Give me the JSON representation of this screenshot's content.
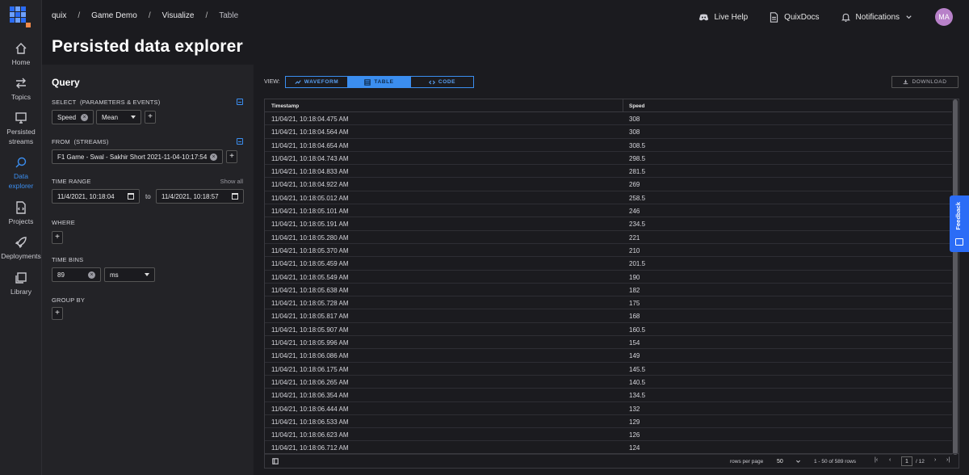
{
  "nav": {
    "items": [
      {
        "label": "Home",
        "icon": "home-icon"
      },
      {
        "label": "Topics",
        "icon": "arrows-icon"
      },
      {
        "label": "Persisted streams",
        "icon": "monitor-icon"
      },
      {
        "label": "Data explorer",
        "icon": "explore-icon"
      },
      {
        "label": "Projects",
        "icon": "code-file-icon"
      },
      {
        "label": "Deployments",
        "icon": "rocket-icon"
      },
      {
        "label": "Library",
        "icon": "library-icon"
      }
    ]
  },
  "header": {
    "breadcrumbs": [
      "quix",
      "Game Demo",
      "Visualize",
      "Table"
    ],
    "separator": "/",
    "title": "Persisted data explorer",
    "live_help": "Live Help",
    "docs": "QuixDocs",
    "notifications": "Notifications",
    "avatar": "MA"
  },
  "query": {
    "title": "Query",
    "select_label": "SELECT",
    "select_sub": "(PARAMETERS & EVENTS)",
    "select_param": "Speed",
    "select_agg": "Mean",
    "from_label": "FROM",
    "from_sub": "(STREAMS)",
    "from_stream": "F1 Game - Swal - Sakhir Short 2021-11-04-10:17:54",
    "time_range_label": "TIME RANGE",
    "show_all": "Show all",
    "time_from": "11/4/2021, 10:18:04",
    "to": "to",
    "time_to": "11/4/2021, 10:18:57",
    "where_label": "WHERE",
    "time_bins_label": "TIME BINS",
    "bin_value": "89",
    "bin_unit": "ms",
    "group_by_label": "GROUP BY",
    "plus": "+"
  },
  "view": {
    "label": "VIEW:",
    "tabs": [
      "WAVEFORM",
      "TABLE",
      "CODE"
    ],
    "active": "TABLE",
    "download": "DOWNLOAD"
  },
  "table": {
    "columns": [
      "Timestamp",
      "Speed"
    ],
    "rows": [
      [
        "11/04/21, 10:18:04.475 AM",
        "308"
      ],
      [
        "11/04/21, 10:18:04.564 AM",
        "308"
      ],
      [
        "11/04/21, 10:18:04.654 AM",
        "308.5"
      ],
      [
        "11/04/21, 10:18:04.743 AM",
        "298.5"
      ],
      [
        "11/04/21, 10:18:04.833 AM",
        "281.5"
      ],
      [
        "11/04/21, 10:18:04.922 AM",
        "269"
      ],
      [
        "11/04/21, 10:18:05.012 AM",
        "258.5"
      ],
      [
        "11/04/21, 10:18:05.101 AM",
        "246"
      ],
      [
        "11/04/21, 10:18:05.191 AM",
        "234.5"
      ],
      [
        "11/04/21, 10:18:05.280 AM",
        "221"
      ],
      [
        "11/04/21, 10:18:05.370 AM",
        "210"
      ],
      [
        "11/04/21, 10:18:05.459 AM",
        "201.5"
      ],
      [
        "11/04/21, 10:18:05.549 AM",
        "190"
      ],
      [
        "11/04/21, 10:18:05.638 AM",
        "182"
      ],
      [
        "11/04/21, 10:18:05.728 AM",
        "175"
      ],
      [
        "11/04/21, 10:18:05.817 AM",
        "168"
      ],
      [
        "11/04/21, 10:18:05.907 AM",
        "160.5"
      ],
      [
        "11/04/21, 10:18:05.996 AM",
        "154"
      ],
      [
        "11/04/21, 10:18:06.086 AM",
        "149"
      ],
      [
        "11/04/21, 10:18:06.175 AM",
        "145.5"
      ],
      [
        "11/04/21, 10:18:06.265 AM",
        "140.5"
      ],
      [
        "11/04/21, 10:18:06.354 AM",
        "134.5"
      ],
      [
        "11/04/21, 10:18:06.444 AM",
        "132"
      ],
      [
        "11/04/21, 10:18:06.533 AM",
        "129"
      ],
      [
        "11/04/21, 10:18:06.623 AM",
        "126"
      ],
      [
        "11/04/21, 10:18:06.712 AM",
        "124"
      ]
    ],
    "footer": {
      "rows_per_page_label": "rows per page",
      "rows_per_page": "50",
      "range": "1 - 50 of 589 rows",
      "page": "1",
      "of_pages": "/ 12"
    }
  },
  "feedback": "Feedback",
  "colors": {
    "accent": "#3b8ef0",
    "brand": "#2b6cf6",
    "avatar": "#b881c9"
  }
}
